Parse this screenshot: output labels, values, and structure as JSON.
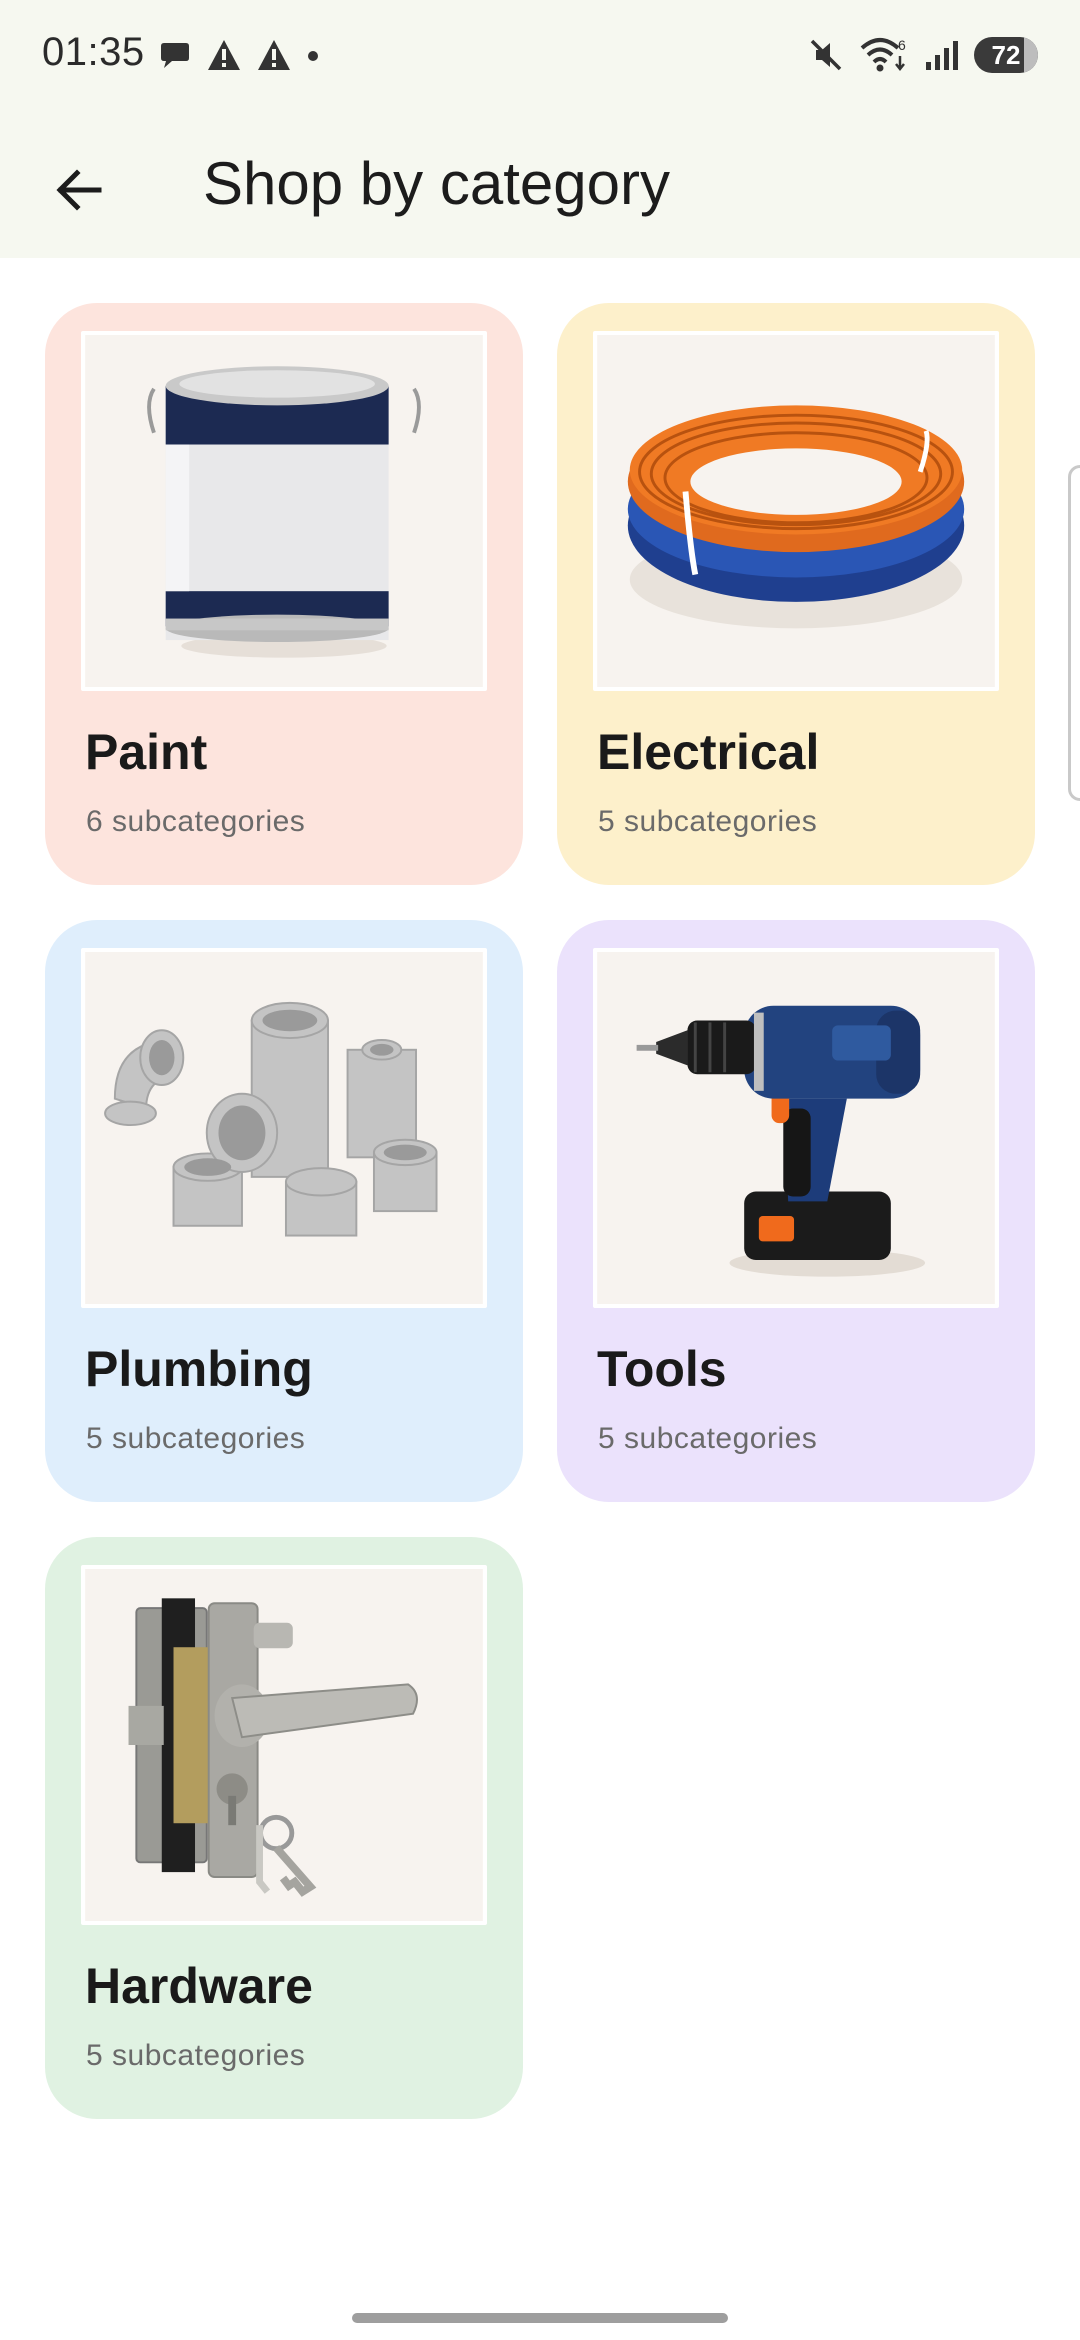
{
  "status_bar": {
    "time": "01:35",
    "left_icons": [
      "chat-bubble-icon",
      "warning-icon",
      "warning-icon",
      "dot-icon"
    ],
    "right_icons": [
      "muted-icon",
      "wifi-icon",
      "signal-icon"
    ],
    "wifi_label": "6",
    "battery": "72"
  },
  "app_bar": {
    "back_icon": "arrow-left-icon",
    "title": "Shop by category"
  },
  "categories": [
    {
      "name": "Paint",
      "subtitle": "6 subcategories",
      "color": "#fde4dd",
      "image": "paint-can"
    },
    {
      "name": "Electrical",
      "subtitle": "5 subcategories",
      "color": "#fdf0cb",
      "image": "wire-coil"
    },
    {
      "name": "Plumbing",
      "subtitle": "5 subcategories",
      "color": "#dfeefc",
      "image": "pipe-fittings"
    },
    {
      "name": "Tools",
      "subtitle": "5 subcategories",
      "color": "#ebe2fc",
      "image": "cordless-drill"
    },
    {
      "name": "Hardware",
      "subtitle": "5 subcategories",
      "color": "#e0f2e2",
      "image": "door-lock"
    }
  ]
}
